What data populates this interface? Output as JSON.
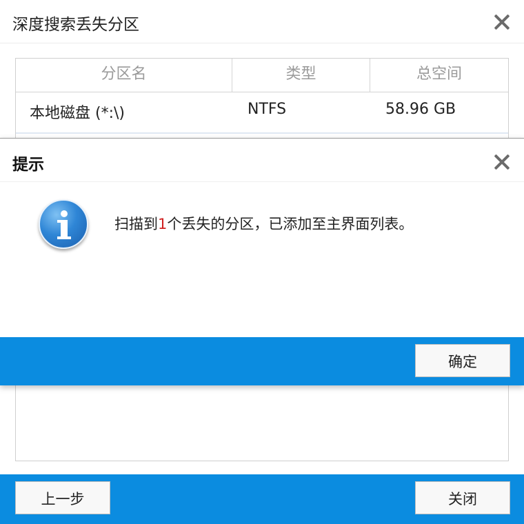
{
  "background_window": {
    "title": "深度搜索丢失分区",
    "table": {
      "columns": [
        "分区名",
        "类型",
        "总空间"
      ],
      "rows": [
        {
          "name": "本地磁盘 (*:\\)",
          "type": "NTFS",
          "size": "58.96 GB"
        }
      ]
    },
    "buttons": {
      "prev": "上一步",
      "close": "关闭"
    }
  },
  "dialog": {
    "title": "提示",
    "message": {
      "before": "扫描到",
      "count": "1",
      "after": "个丢失的分区，已添加至主界面列表。"
    },
    "ok_label": "确定"
  },
  "colors": {
    "footer_blue": "#0b8ce0",
    "highlight_red": "#d02020"
  },
  "icons": {
    "dialog_icon": "info-icon",
    "close_icon": "close-icon"
  }
}
